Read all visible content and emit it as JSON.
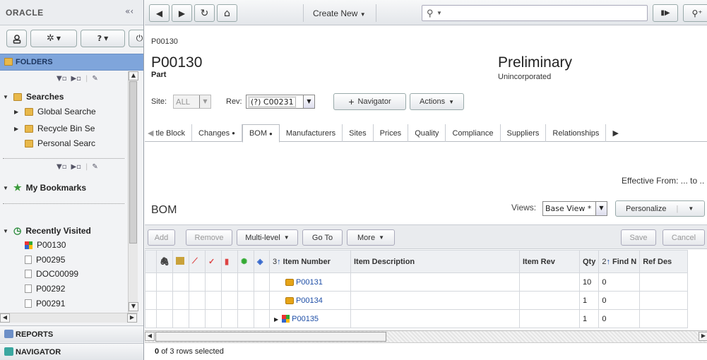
{
  "sidebar": {
    "logo": "ORACLE",
    "collapse_glyph": "«‹",
    "folders_header": "FOLDERS",
    "reports_header": "REPORTS",
    "navigator_header": "NAVIGATOR",
    "searches": {
      "label": "Searches",
      "items": [
        "Global Searche",
        "Recycle Bin Se",
        "Personal Searc"
      ]
    },
    "bookmarks_label": "My Bookmarks",
    "recently_visited": {
      "label": "Recently Visited",
      "items": [
        {
          "label": "P00130",
          "icon": "part-icon"
        },
        {
          "label": "P00295",
          "icon": "document-icon"
        },
        {
          "label": "DOC00099",
          "icon": "document-icon"
        },
        {
          "label": "P00292",
          "icon": "document-icon"
        },
        {
          "label": "P00291",
          "icon": "document-icon"
        }
      ]
    }
  },
  "topbar": {
    "create_new": "Create New",
    "search_placeholder": "Q"
  },
  "object": {
    "breadcrumb": "P00130",
    "number": "P00130",
    "type": "Part",
    "lifecycle": "Preliminary",
    "status": "Unincorporated",
    "site_label": "Site:",
    "site_value": "ALL",
    "rev_label": "Rev:",
    "rev_value": "(?) C00231",
    "navigator_label": "Navigator",
    "actions_label": "Actions"
  },
  "tabs": [
    "tle Block",
    "Changes",
    "BOM",
    "Manufacturers",
    "Sites",
    "Prices",
    "Quality",
    "Compliance",
    "Suppliers",
    "Relationships"
  ],
  "active_tab": "BOM",
  "bom": {
    "effective_from": "Effective From: ... to ..",
    "section_title": "BOM",
    "views_label": "Views:",
    "views_value": "Base View *",
    "personalize": "Personalize",
    "toolbar": {
      "add": "Add",
      "remove": "Remove",
      "multilevel": "Multi-level",
      "goto": "Go To",
      "more": "More",
      "save": "Save",
      "cancel": "Cancel"
    },
    "columns": {
      "item_number": "Item Number",
      "item_number_sort": "3",
      "item_description": "Item Description",
      "item_rev": "Item Rev",
      "qty": "Qty",
      "find_num": "Find N",
      "find_num_sort": "2",
      "ref_des": "Ref Des"
    },
    "rows": [
      {
        "number": "P00131",
        "description": "",
        "rev": "",
        "qty": "10",
        "find": "0",
        "ref": ""
      },
      {
        "number": "P00134",
        "description": "",
        "rev": "",
        "qty": "1",
        "find": "0",
        "ref": ""
      },
      {
        "number": "P00135",
        "description": "",
        "rev": "",
        "qty": "1",
        "find": "0",
        "ref": ""
      }
    ],
    "selection_count": "0",
    "selection_text": "of 3 rows selected"
  },
  "colors": {
    "accent": "#7fa5db",
    "link": "#1f4fa7",
    "folder": "#e8b84a",
    "part_cube": "#e6a417"
  }
}
